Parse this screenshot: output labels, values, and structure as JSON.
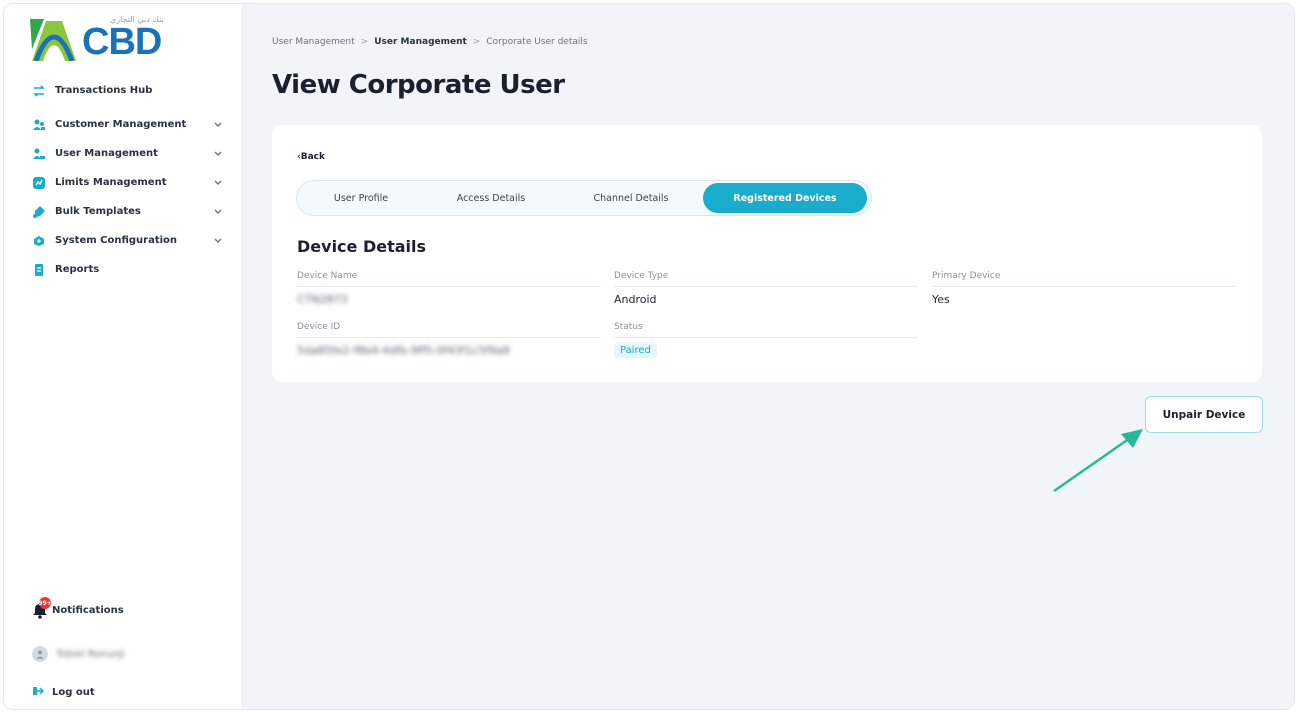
{
  "brand": {
    "logo_text": "CBD",
    "arabic_text": "بنك دبي التجاري",
    "colors": {
      "logo_green": "#2fa84f",
      "logo_blue": "#1a73b8",
      "accent": "#1aaccc",
      "annotation_arrow": "#27b79a"
    }
  },
  "sidebar": {
    "items": [
      {
        "label": "Transactions Hub",
        "icon": "transactions-icon",
        "has_dropdown": false
      },
      {
        "label": "Customer Management",
        "icon": "customers-icon",
        "has_dropdown": true
      },
      {
        "label": "User Management",
        "icon": "user-icon",
        "has_dropdown": true
      },
      {
        "label": "Limits Management",
        "icon": "limits-icon",
        "has_dropdown": true
      },
      {
        "label": "Bulk Templates",
        "icon": "templates-icon",
        "has_dropdown": true
      },
      {
        "label": "System Configuration",
        "icon": "settings-icon",
        "has_dropdown": true
      },
      {
        "label": "Reports",
        "icon": "reports-icon",
        "has_dropdown": false
      }
    ],
    "notifications": {
      "label": "Notifications",
      "badge": "99+"
    },
    "user": {
      "name": "Tobiel Ronunji"
    },
    "logout": {
      "label": "Log out"
    }
  },
  "breadcrumb": {
    "items": [
      "User Management",
      "User Management",
      "Corporate User details"
    ],
    "separator": ">"
  },
  "page": {
    "title": "View Corporate User"
  },
  "card": {
    "back_label": "Back",
    "tabs": [
      {
        "label": "User Profile",
        "active": false
      },
      {
        "label": "Access Details",
        "active": false
      },
      {
        "label": "Channel Details",
        "active": false
      },
      {
        "label": "Registered Devices",
        "active": true
      }
    ],
    "section_title": "Device Details",
    "fields": {
      "device_name": {
        "label": "Device Name",
        "value": "CTN2873"
      },
      "device_type": {
        "label": "Device Type",
        "value": "Android"
      },
      "primary_device": {
        "label": "Primary Device",
        "value": "Yes"
      },
      "device_id": {
        "label": "Device ID",
        "value": "5da85fe2-f8b4-4dfb-9ff5-0f43f1c5f9a8"
      },
      "status": {
        "label": "Status",
        "value": "Paired"
      }
    }
  },
  "actions": {
    "unpair_label": "Unpair Device"
  }
}
